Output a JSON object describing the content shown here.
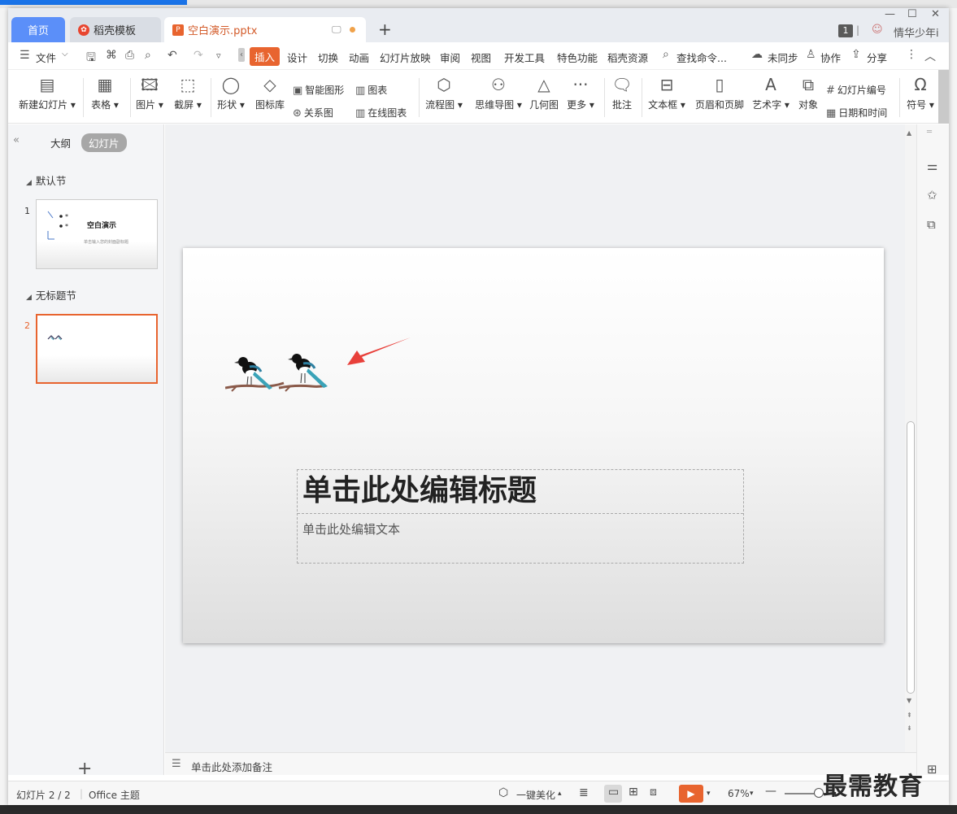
{
  "tabs": {
    "home": "首页",
    "template": "稻壳模板",
    "document": "空白演示.pptx",
    "add": "+"
  },
  "window": {
    "minimize": "—",
    "restore": "☐",
    "close": "✕",
    "badge": "1",
    "user": "情华少年i"
  },
  "menu": {
    "file": "文件",
    "items": [
      "插入",
      "设计",
      "切换",
      "动画",
      "幻灯片放映",
      "审阅",
      "视图",
      "开发工具",
      "特色功能",
      "稻壳资源"
    ],
    "search": "查找命令...",
    "sync": "未同步",
    "collab": "协作",
    "share": "分享"
  },
  "ribbon": {
    "new_slide": "新建幻灯片",
    "table": "表格",
    "picture": "图片",
    "screenshot": "截屏",
    "shape": "形状",
    "icon_lib": "图标库",
    "smart_shape": "智能图形",
    "relation": "关系图",
    "chart": "图表",
    "online_chart": "在线图表",
    "flowchart": "流程图",
    "mindmap": "思维导图",
    "geometry": "几何图",
    "more": "更多",
    "comment": "批注",
    "textbox": "文本框",
    "header_footer": "页眉和页脚",
    "wordart": "艺术字",
    "object": "对象",
    "slide_number": "幻灯片编号",
    "datetime": "日期和时间",
    "symbol": "符号"
  },
  "left_panel": {
    "outline": "大纲",
    "slides": "幻灯片",
    "section1": "默认节",
    "section2": "无标题节",
    "thumb1_num": "1",
    "thumb1_title": "空白演示",
    "thumb1_sub": "单击输入您的封面副标题",
    "thumb2_num": "2",
    "add": "+"
  },
  "slide": {
    "title_placeholder": "单击此处编辑标题",
    "text_placeholder": "单击此处编辑文本"
  },
  "notes": {
    "placeholder": "单击此处添加备注"
  },
  "status": {
    "slide_count": "幻灯片 2 / 2",
    "theme": "Office 主题",
    "beautify": "一键美化",
    "zoom": "67%",
    "watermark": "最需教育"
  },
  "colors": {
    "accent": "#e8642f",
    "home_tab": "#5b8ff9",
    "arrow": "#e8403a"
  }
}
